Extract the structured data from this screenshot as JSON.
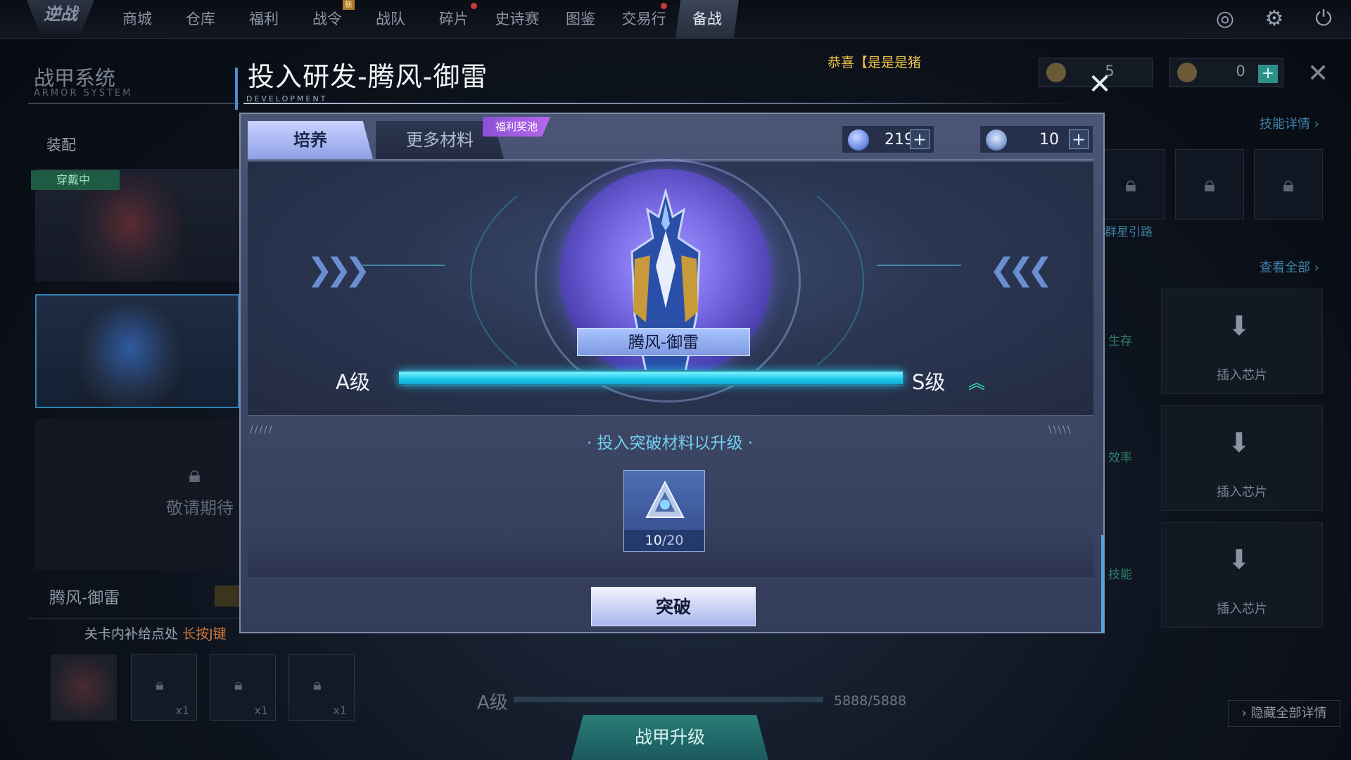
{
  "nav": {
    "logo": "逆战",
    "items": [
      {
        "label": "商城",
        "dot": false,
        "new": ""
      },
      {
        "label": "仓库",
        "dot": false,
        "new": ""
      },
      {
        "label": "福利",
        "dot": false,
        "new": ""
      },
      {
        "label": "战令",
        "dot": false,
        "new": "新"
      },
      {
        "label": "战队",
        "dot": false,
        "new": ""
      },
      {
        "label": "碎片",
        "dot": true,
        "new": ""
      },
      {
        "label": "史诗赛",
        "dot": false,
        "new": ""
      },
      {
        "label": "图鉴",
        "dot": false,
        "new": ""
      },
      {
        "label": "交易行",
        "dot": true,
        "new": ""
      },
      {
        "label": "备战",
        "dot": false,
        "new": ""
      }
    ],
    "active_index": 9,
    "icons": [
      "radar-icon",
      "gear-icon",
      "power-icon"
    ]
  },
  "background": {
    "system_title": "战甲系统",
    "system_subtitle": "ARMOR SYSTEM",
    "equip_label": "装配",
    "wearing_badge": "穿戴中",
    "stay_tuned": "敬请期待",
    "armor_name": "腾风-御雷",
    "tip_prefix": "关卡内补给点处",
    "tip_highlight": "长按J键",
    "slot_multiplier": "x1",
    "currency_a": "5",
    "currency_b": "0",
    "skill_detail": "技能详情",
    "star_road": "群星引路",
    "view_all": "查看全部",
    "tags": [
      "生存",
      "效率",
      "技能"
    ],
    "chip_label": "插入芯片",
    "hide_details": "隐藏全部详情",
    "bottom_grade": "A级",
    "bottom_count": "5888/5888",
    "armor_upgrade": "战甲升级"
  },
  "announcement": "恭喜【是是是猪",
  "modal": {
    "title": "投入研发-腾风-御雷",
    "subtitle": "DEVELOPMENT",
    "tabs": [
      {
        "label": "培养",
        "active": true
      },
      {
        "label": "更多材料",
        "active": false
      }
    ],
    "tab_badge": "福利奖池",
    "resources": [
      {
        "icon": "crystal-coin-icon",
        "value": "2192",
        "color": "#6f8fe8"
      },
      {
        "icon": "core-shard-icon",
        "value": "10",
        "color": "#88a6d8"
      }
    ],
    "armor_name": "腾风-御雷",
    "current_grade": "A级",
    "next_grade": "S级",
    "progress": 1.0,
    "progress_color": "#1ac8ec",
    "hint": "· 投入突破材料以升级 ·",
    "material": {
      "icon": "breakthrough-core-icon",
      "owned": "10",
      "required": "/20"
    },
    "action_button": "突破"
  }
}
